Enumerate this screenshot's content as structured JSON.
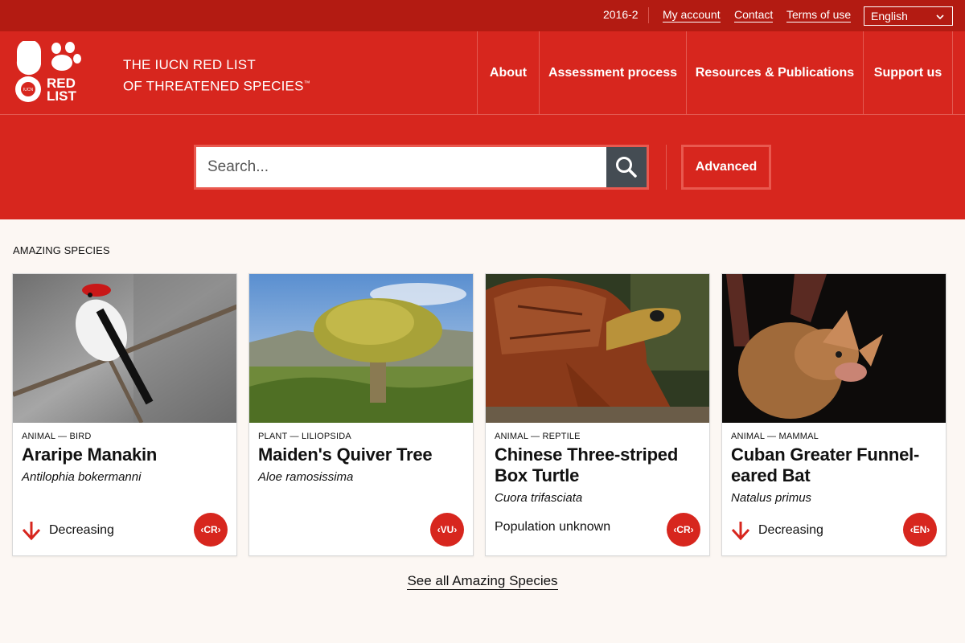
{
  "topbar": {
    "version": "2016-2",
    "links": [
      "My account",
      "Contact",
      "Terms of use"
    ],
    "language": "English"
  },
  "header": {
    "brand_line1": "THE IUCN RED LIST",
    "brand_line2": "OF THREATENED SPECIES",
    "brand_tm": "™",
    "logo_text_line1": "RED",
    "logo_text_line2": "LIST",
    "logo_small": "IUCN",
    "nav": [
      "About",
      "Assessment process",
      "Resources & Publications",
      "Support us"
    ]
  },
  "search": {
    "placeholder": "Search...",
    "advanced_label": "Advanced",
    "icon": "search-icon"
  },
  "section_title": "AMAZING SPECIES",
  "species": [
    {
      "category": "ANIMAL — BIRD",
      "name": "Araripe Manakin",
      "scientific": "Antilophia bokermanni",
      "trend": "Decreasing",
      "status": "CR"
    },
    {
      "category": "PLANT — LILIOPSIDA",
      "name": "Maiden's Quiver Tree",
      "scientific": "Aloe ramosissima",
      "trend": "",
      "status": "VU"
    },
    {
      "category": "ANIMAL — REPTILE",
      "name": "Chinese Three-striped Box Turtle",
      "scientific": "Cuora trifasciata",
      "trend": "Population unknown",
      "status": "CR"
    },
    {
      "category": "ANIMAL — MAMMAL",
      "name": "Cuban Greater Funnel-eared Bat",
      "scientific": "Natalus primus",
      "trend": "Decreasing",
      "status": "EN"
    }
  ],
  "see_all": "See all Amazing Species",
  "colors": {
    "red": "#d7261e",
    "dark_red": "#b31b12",
    "search_button": "#444c53"
  }
}
